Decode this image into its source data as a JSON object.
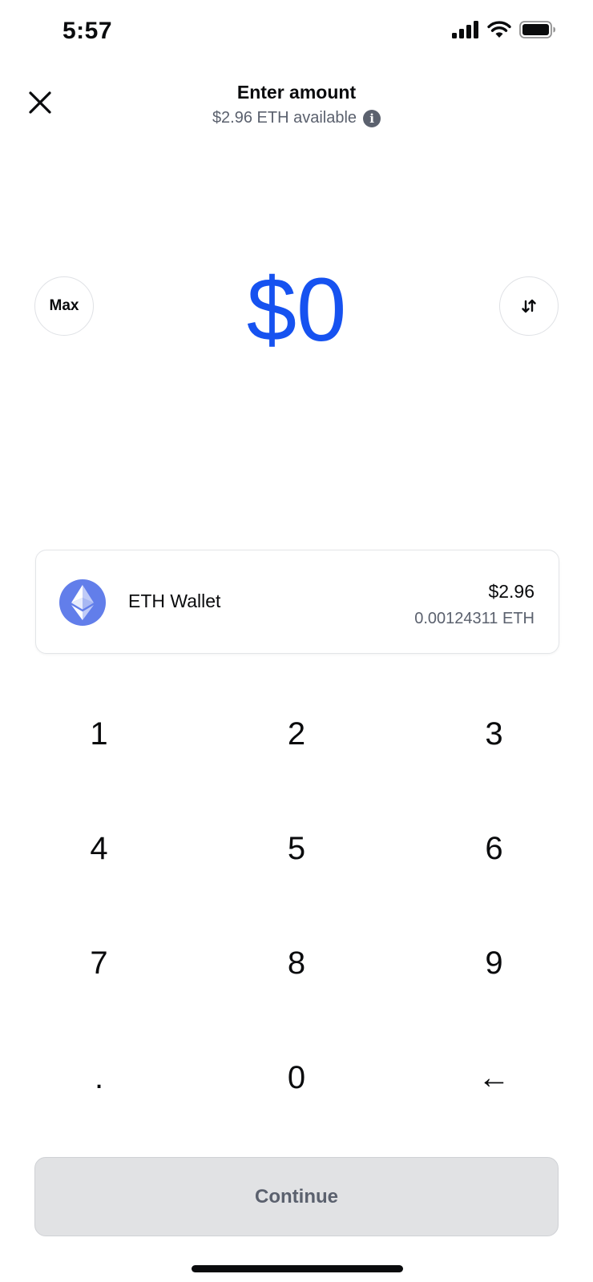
{
  "status_bar": {
    "time": "5:57",
    "icons": [
      "cellular-signal-icon",
      "wifi-icon",
      "battery-icon"
    ]
  },
  "header": {
    "title": "Enter amount",
    "subtitle": "$2.96 ETH available",
    "close_icon": "close-icon",
    "info_icon": "info-icon",
    "info_glyph": "i"
  },
  "amount": {
    "value": "$0",
    "max_label": "Max",
    "swap_icon": "swap-arrows-icon"
  },
  "wallet": {
    "name": "ETH Wallet",
    "fiat_balance": "$2.96",
    "crypto_balance": "0.00124311 ETH",
    "icon": "ethereum-icon"
  },
  "keypad": {
    "keys": [
      "1",
      "2",
      "3",
      "4",
      "5",
      "6",
      "7",
      "8",
      "9",
      ".",
      "0",
      "←"
    ]
  },
  "continue_label": "Continue",
  "colors": {
    "accent": "#1652f0",
    "eth_brand": "#627eea",
    "muted_text": "#5b616e",
    "disabled_button": "#e1e2e4"
  }
}
